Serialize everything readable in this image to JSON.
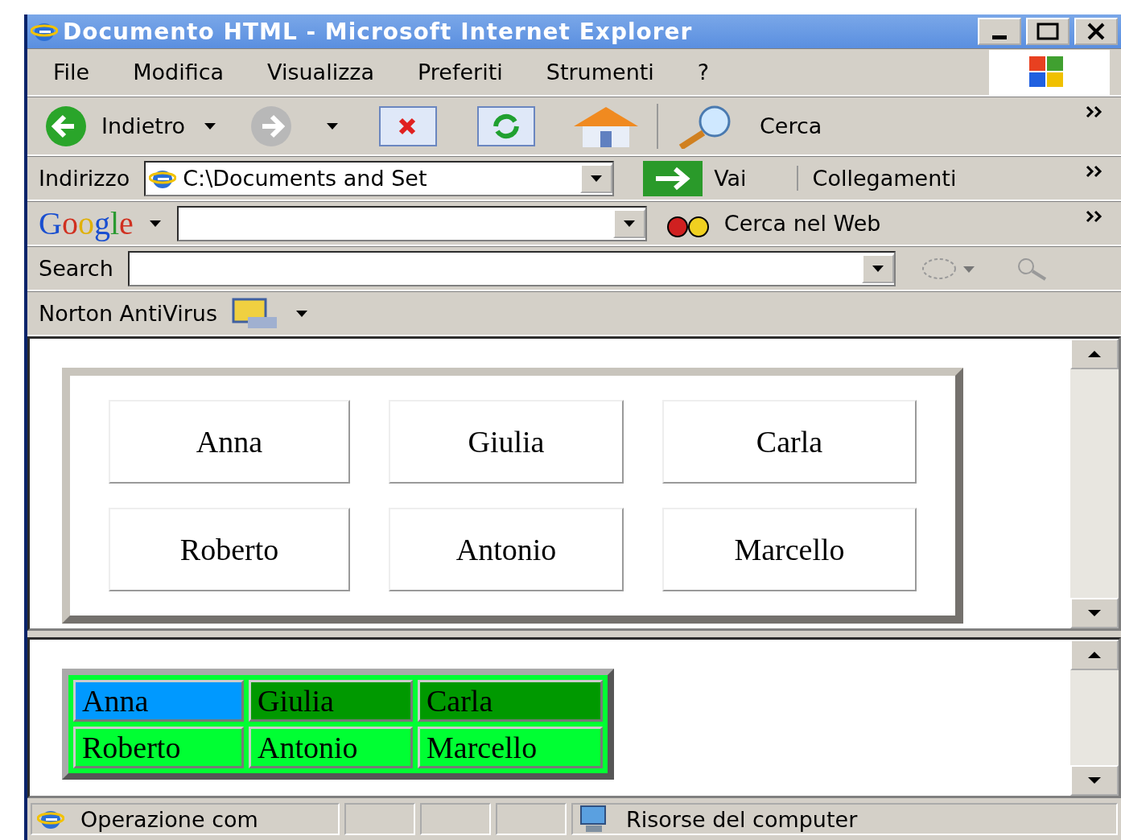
{
  "window": {
    "title": "Documento HTML - Microsoft Internet Explorer"
  },
  "menu": [
    "File",
    "Modifica",
    "Visualizza",
    "Preferiti",
    "Strumenti",
    "?"
  ],
  "toolbar": {
    "back": "Indietro",
    "search": "Cerca"
  },
  "address": {
    "label": "Indirizzo",
    "value": "C:\\Documents and Set",
    "go": "Vai",
    "links": "Collegamenti"
  },
  "google": {
    "logo": "Google",
    "search": "Cerca nel Web"
  },
  "searchbar": {
    "label": "Search"
  },
  "norton": {
    "label": "Norton AntiVirus"
  },
  "frame1": {
    "rows": [
      [
        "Anna",
        "Giulia",
        "Carla"
      ],
      [
        "Roberto",
        "Antonio",
        "Marcello"
      ]
    ]
  },
  "frame2": {
    "rows": [
      [
        {
          "text": "Anna",
          "color": "#0099ff"
        },
        {
          "text": "Giulia",
          "color": "#009900"
        },
        {
          "text": "Carla",
          "color": "#009900"
        }
      ],
      [
        {
          "text": "Roberto",
          "color": "#00ff33"
        },
        {
          "text": "Antonio",
          "color": "#00ff33"
        },
        {
          "text": "Marcello",
          "color": "#00ff33"
        }
      ]
    ]
  },
  "status": {
    "text": "Operazione com",
    "zone": "Risorse del computer"
  }
}
